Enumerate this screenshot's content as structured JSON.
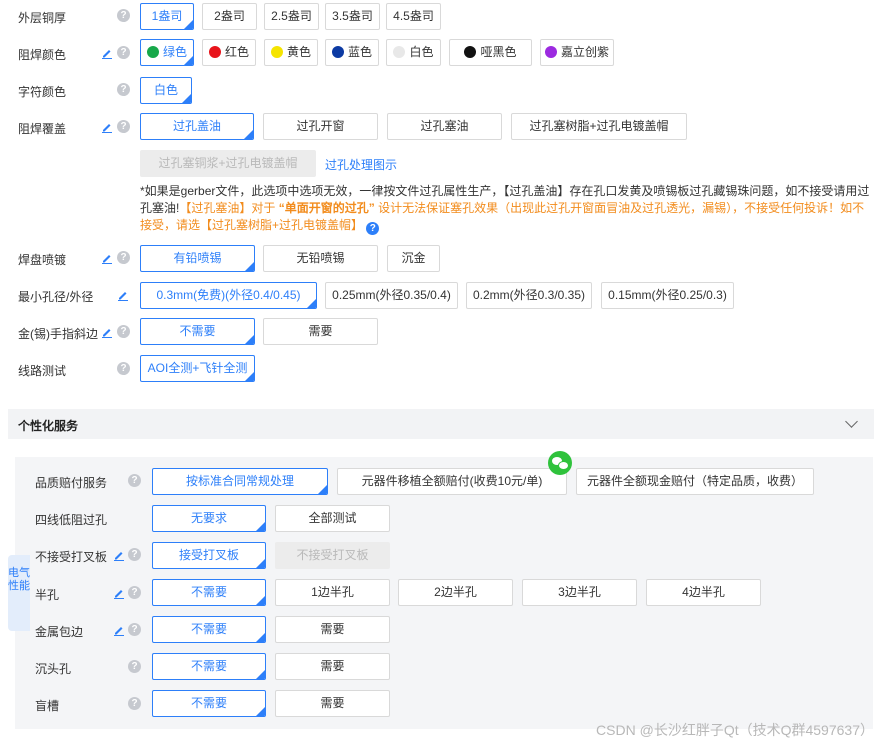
{
  "rows": {
    "outer_copper": {
      "label": "外层铜厚",
      "options": [
        "1盎司",
        "2盎司",
        "2.5盎司",
        "3.5盎司",
        "4.5盎司"
      ]
    },
    "mask_color": {
      "label": "阻焊颜色",
      "options": [
        "绿色",
        "红色",
        "黄色",
        "蓝色",
        "白色",
        "哑黑色",
        "嘉立创紫"
      ],
      "dots": [
        "#17a84a",
        "#e8141b",
        "#f5e400",
        "#0c3aa3",
        "#e8e8e8",
        "#111111",
        "#9c2ae0"
      ]
    },
    "silk_color": {
      "label": "字符颜色",
      "options": [
        "白色"
      ]
    },
    "mask_cover": {
      "label": "阻焊覆盖",
      "options": [
        "过孔盖油",
        "过孔开窗",
        "过孔塞油",
        "过孔塞树脂+过孔电镀盖帽",
        "过孔塞铜浆+过孔电镀盖帽"
      ],
      "link": "过孔处理图示"
    },
    "note": {
      "p1": "*如果是gerber文件，此选项中选项无效，一律按文件过孔属性生产，【过孔盖油】存在孔口发黄及喷锡板过孔藏锡珠问题，如不接受请用过孔塞油!",
      "p2": "【过孔塞油】对于",
      "p3": "“单面开窗的过孔”",
      "p4": "设计无法保证塞孔效果（出现此过孔开窗面冒油及过孔透光，漏锡），不接受任何投诉！如不接受，请选【过孔塞树脂+过孔电镀盖帽】"
    },
    "surface": {
      "label": "焊盘喷镀",
      "options": [
        "有铅喷锡",
        "无铅喷锡",
        "沉金"
      ]
    },
    "min_hole": {
      "label": "最小孔径/外径",
      "options": [
        "0.3mm(免费)(外径0.4/0.45)",
        "0.25mm(外径0.35/0.4)",
        "0.2mm(外径0.3/0.35)",
        "0.15mm(外径0.25/0.3)"
      ]
    },
    "bevel": {
      "label": "金(锡)手指斜边",
      "options": [
        "不需要",
        "需要"
      ]
    },
    "test": {
      "label": "线路测试",
      "options": [
        "AOI全测+飞针全测"
      ]
    }
  },
  "section": {
    "title": "个性化服务"
  },
  "sidetab": "电气性能",
  "panel": {
    "quality": {
      "label": "品质赔付服务",
      "options": [
        "按标准合同常规处理",
        "元器件移植全额赔付(收费10元/单)",
        "元器件全额现金赔付（特定品质，收费）"
      ]
    },
    "four_wire": {
      "label": "四线低阻过孔",
      "options": [
        "无要求",
        "全部测试"
      ]
    },
    "x_board": {
      "label": "不接受打叉板",
      "options": [
        "接受打叉板",
        "不接受打叉板"
      ]
    },
    "half_hole": {
      "label": "半孔",
      "options": [
        "不需要",
        "1边半孔",
        "2边半孔",
        "3边半孔",
        "4边半孔"
      ]
    },
    "metal_edge": {
      "label": "金属包边",
      "options": [
        "不需要",
        "需要"
      ]
    },
    "countersink": {
      "label": "沉头孔",
      "options": [
        "不需要",
        "需要"
      ]
    },
    "blind_slot": {
      "label": "盲槽",
      "options": [
        "不需要",
        "需要"
      ]
    }
  },
  "watermark": "CSDN @长沙红胖子Qt（技术Q群4597637）"
}
